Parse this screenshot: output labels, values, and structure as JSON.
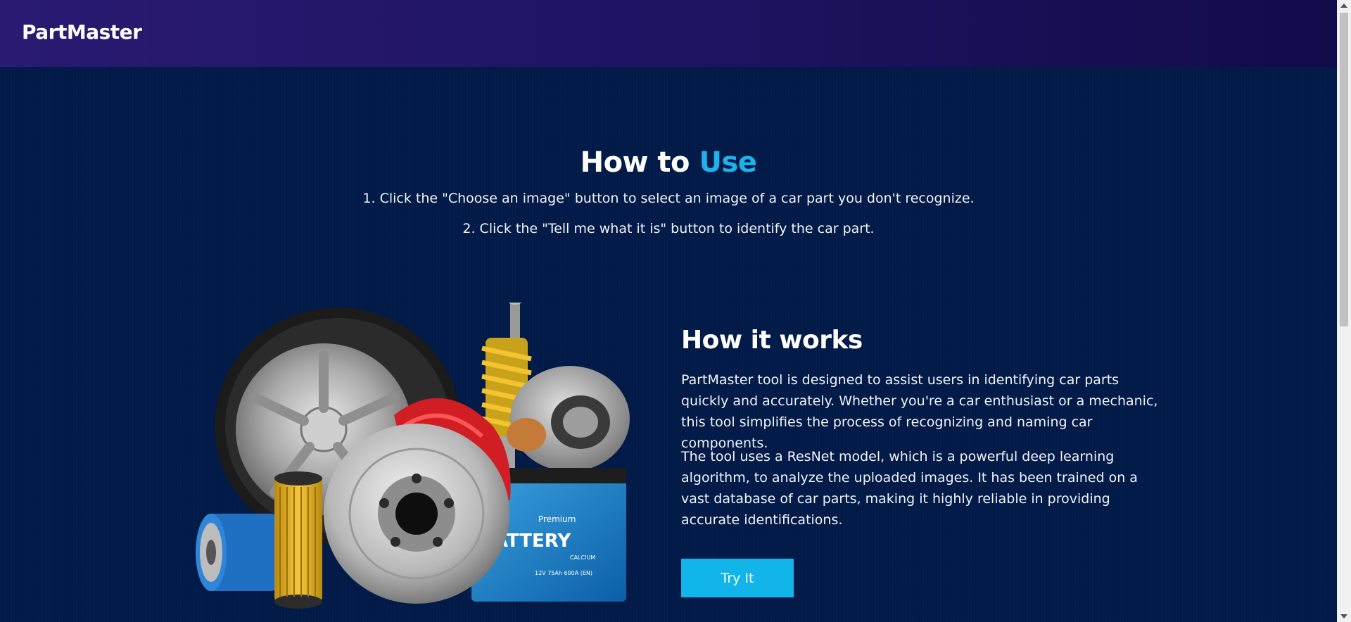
{
  "header": {
    "brand": "PartMaster"
  },
  "how_to": {
    "title_main": "How to ",
    "title_accent": "Use",
    "steps": [
      "1. Click the \"Choose an image\" button to select an image of a car part you don't recognize.",
      "2. Click the \"Tell me what it is\" button to identify the car part."
    ]
  },
  "how_it_works": {
    "title": "How it works",
    "paragraphs": [
      "PartMaster tool is designed to assist users in identifying car parts quickly and accurately. Whether you're a car enthusiast or a mechanic, this tool simplifies the process of recognizing and naming car components.",
      "The tool uses a ResNet model, which is a powerful deep learning algorithm, to analyze the uploaded images. It has been trained on a vast database of car parts, making it highly reliable in providing accurate identifications."
    ],
    "button_label": "Try It"
  },
  "image": {
    "battery_label": "BATTERY",
    "battery_brand": "Premium",
    "battery_sub": "CALCIUM",
    "battery_spec": "12V 75Ah 600A (EN)"
  },
  "colors": {
    "background": "#011a47",
    "header": "#1d1360",
    "accent": "#1fb2ea",
    "button": "#12b5e9"
  }
}
